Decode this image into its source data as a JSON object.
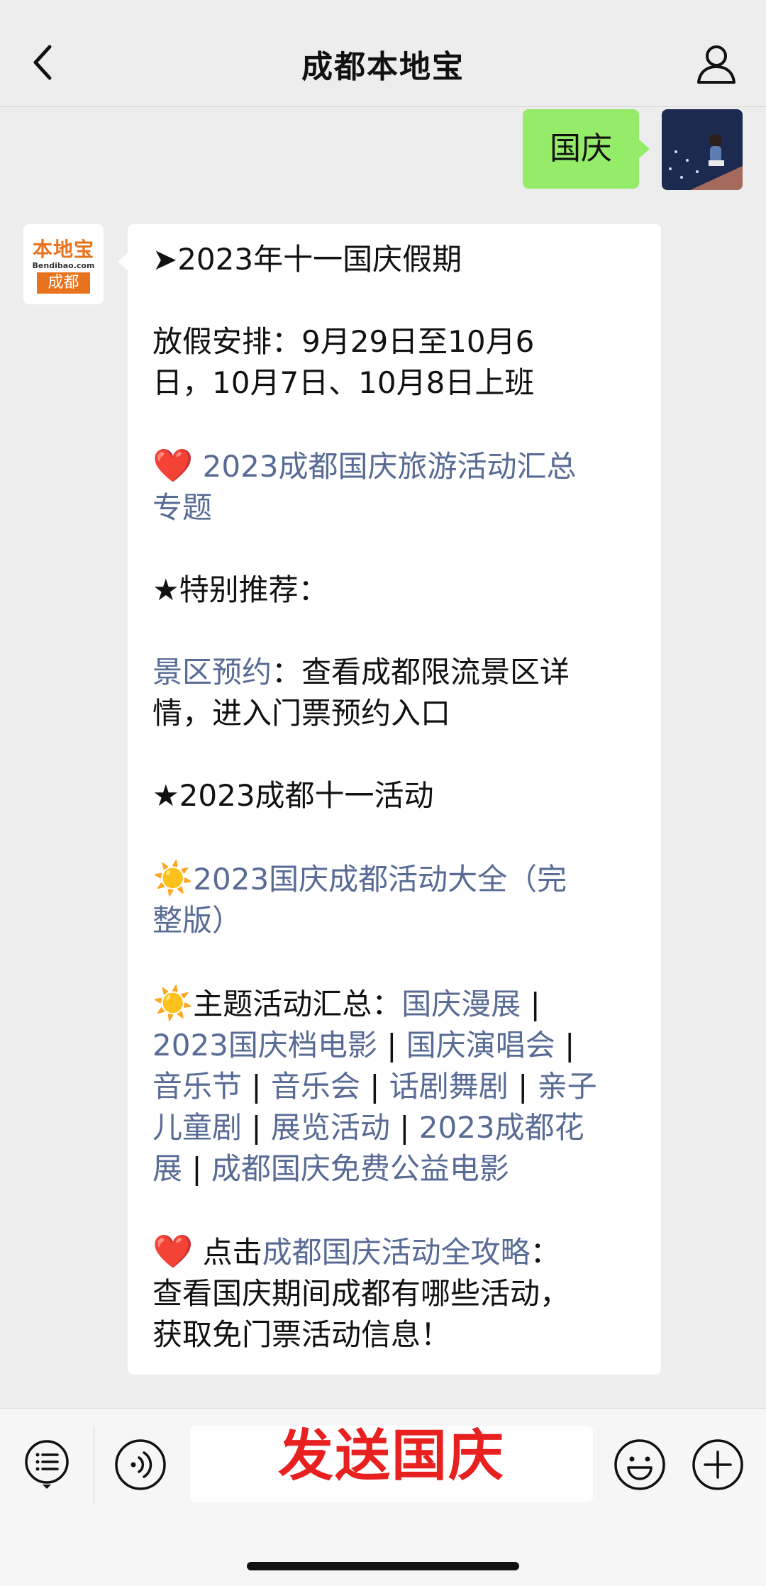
{
  "header": {
    "title": "成都本地宝"
  },
  "outgoing": {
    "text": "国庆"
  },
  "sender": {
    "logo_top": "本地宝",
    "logo_mid": "Bendibao.com",
    "logo_bottom": "成都"
  },
  "message": {
    "l1": "➤2023年十一国庆假期",
    "l2a": "放假安排：9月29日至10月6",
    "l2b": "日，10月7日、10月8日上班",
    "heart": "❤️",
    "l3_link_a": "2023成都国庆旅游活动汇总",
    "l3_link_b": "专题",
    "l4": "★特别推荐：",
    "l5_link": "景区预约",
    "l5_rest": "：查看成都限流景区详",
    "l5b": "情，进入门票预约入口",
    "l6": "★2023成都十一活动",
    "sun": "☀️",
    "l7_link_a": "2023国庆成都活动大全（完",
    "l7_link_b": "整版）",
    "l8_prefix": "主题活动汇总：",
    "sep": " | ",
    "links": [
      "国庆漫展",
      "2023国庆档电影",
      "国庆演唱会",
      "音乐节",
      "音乐会",
      "话剧舞剧",
      "亲子",
      "儿童剧",
      "展览活动",
      "2023成都花",
      "展",
      "成都国庆免费公益电影"
    ],
    "l9_prefix": " 点击",
    "l9_link": "成都国庆活动全攻略",
    "l9_suffix": "：",
    "l9b": "查看国庆期间成都有哪些活动，",
    "l9c": "获取免门票活动信息！"
  },
  "input": {
    "overlay": "发送国庆"
  },
  "colors": {
    "link": "#576b95",
    "bubble_out": "#95ec69",
    "overlay": "#e8201f",
    "brand": "#e8731c"
  }
}
